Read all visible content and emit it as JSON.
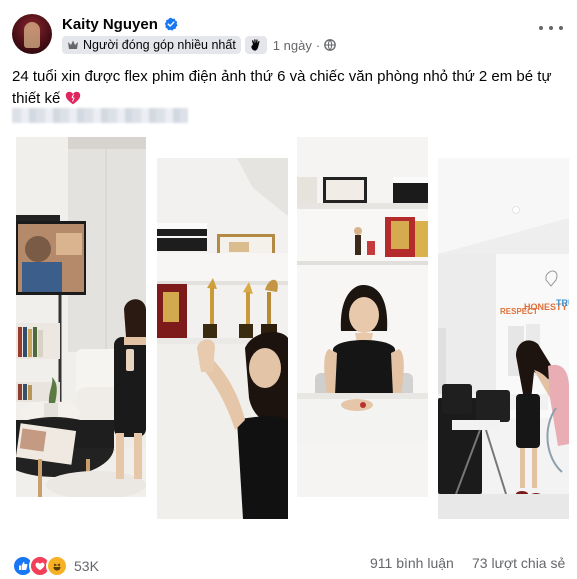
{
  "post": {
    "author": "Kaity Nguyen",
    "badge": "Người đóng góp nhiều nhất",
    "time": "1 ngày",
    "caption": "24 tuổi xin được flex phim điện ảnh thứ 6 và chiếc văn phòng nhỏ thứ 2 em bé tự thiết kế",
    "icons": {
      "verified": "verified-badge-icon",
      "badge": "top-fan-icon",
      "wave": "wave-hand-icon",
      "audience": "globe-icon",
      "more": "more-options-icon",
      "caption_emoji": "heart-icon"
    },
    "photos": [
      {
        "name": "photo-1"
      },
      {
        "name": "photo-2"
      },
      {
        "name": "photo-3"
      },
      {
        "name": "photo-4"
      }
    ],
    "photo_text": {
      "wall_slogan_1": "RESPECT",
      "wall_slogan_2": "HONESTY",
      "wall_slogan_3": "TRU"
    }
  },
  "footer": {
    "reactions": [
      "like",
      "love",
      "haha"
    ],
    "reaction_count": "53K",
    "comments": "911 bình luận",
    "shares": "73 lượt chia sẻ"
  },
  "colors": {
    "accent": "#1877f2",
    "secondary_text": "#65676b",
    "love": "#f33e58",
    "haha": "#f7b125"
  }
}
